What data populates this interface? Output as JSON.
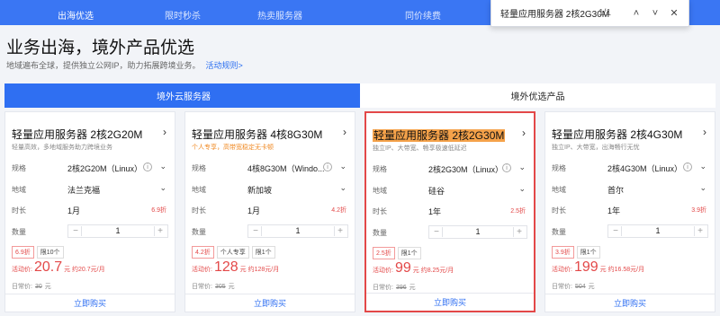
{
  "topnav": {
    "tabs": [
      "出海优选",
      "限时秒杀",
      "热卖服务器",
      "同价续费"
    ]
  },
  "findbar": {
    "query": "轻量应用服务器 2核2G30M",
    "count": "1/1",
    "up": "˄",
    "down": "˅",
    "close": "✕"
  },
  "header": {
    "title": "业务出海，境外产品优选",
    "subtitle": "地域遍布全球，提供独立公网IP，助力拓展跨境业务。",
    "rules_link": "活动规则>"
  },
  "segments": {
    "left": "境外云服务器",
    "right": "境外优选产品"
  },
  "labels": {
    "spec": "规格",
    "region": "地域",
    "duration": "时长",
    "quantity": "数量",
    "activity_price": "活动价:",
    "daily_price": "日常价:",
    "buy": "立即购买",
    "arrow": "›",
    "dd": "⌄",
    "minus": "−",
    "plus": "+",
    "info": "i"
  },
  "cards": [
    {
      "name": "轻量应用服务器 2核2G20M",
      "desc": "轻量高效，多地域服务助力跨境业务",
      "spec": "2核2G20M（Linux）",
      "region": "法兰克福",
      "duration": "1月",
      "discount": "6.9折",
      "qty": "1",
      "tags": [
        "6.9折",
        "限10个"
      ],
      "price": "20.7",
      "unit_note": "元 约20.7元/月",
      "orig": "30",
      "orig_unit": "元"
    },
    {
      "name": "轻量应用服务器 4核8G30M",
      "desc": "个人专享，高带宽稳定无卡顿",
      "spec": "4核8G30M（Windo...",
      "region": "新加坡",
      "duration": "1月",
      "discount": "4.2折",
      "qty": "1",
      "tags": [
        "4.2折",
        "个人专享",
        "限1个"
      ],
      "price": "128",
      "unit_note": "元 约128元/月",
      "orig": "305",
      "orig_unit": "元"
    },
    {
      "name": "轻量应用服务器 2核2G30M",
      "desc": "独立IP、大带宽、畅享极速低延迟",
      "spec": "2核2G30M（Linux）",
      "region": "硅谷",
      "duration": "1年",
      "discount": "2.5折",
      "qty": "1",
      "tags": [
        "2.5折",
        "限1个"
      ],
      "price": "99",
      "unit_note": "元 约8.25元/月",
      "orig": "396",
      "orig_unit": "元"
    },
    {
      "name": "轻量应用服务器 2核4G30M",
      "desc": "独立IP、大带宽，出海畅行无忧",
      "spec": "2核4G30M（Linux）",
      "region": "首尔",
      "duration": "1年",
      "discount": "3.9折",
      "qty": "1",
      "tags": [
        "3.9折",
        "限1个"
      ],
      "price": "199",
      "unit_note": "元 约16.58元/月",
      "orig": "504",
      "orig_unit": "元"
    }
  ]
}
